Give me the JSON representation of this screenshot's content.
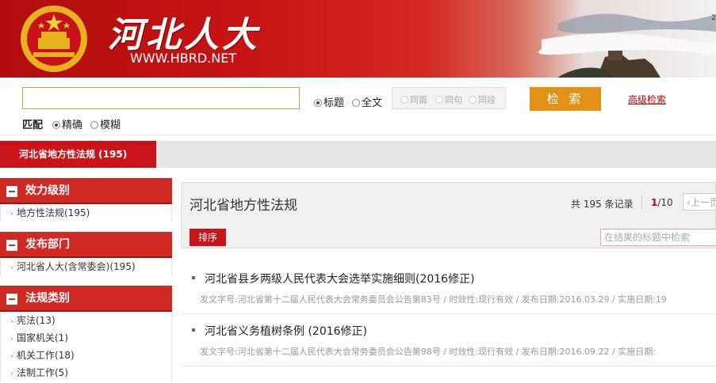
{
  "header": {
    "brand": "河北人大",
    "site_url": "WWW.HBRD.NET",
    "corner_mark": "2"
  },
  "search": {
    "query": "",
    "scope_options": [
      {
        "label": "标题",
        "checked": true
      },
      {
        "label": "全文",
        "checked": false
      }
    ],
    "proximity_options": [
      {
        "label": "同篇"
      },
      {
        "label": "同句"
      },
      {
        "label": "同段"
      }
    ],
    "button_label": "检 索",
    "advanced_link": "高级检索",
    "match_label": "匹配",
    "match_options": [
      {
        "label": "精确",
        "checked": true
      },
      {
        "label": "模糊",
        "checked": false
      }
    ]
  },
  "tab": {
    "active_label": "河北省地方性法规 (195)"
  },
  "sidebar": {
    "groups": [
      {
        "title": "效力级别",
        "items": [
          "地方性法规(195)"
        ]
      },
      {
        "title": "发布部门",
        "items": [
          "河北省人大(含常委会)(195)"
        ]
      },
      {
        "title": "法规类别",
        "items": [
          "宪法(13)",
          "国家机关(1)",
          "机关工作(18)",
          "法制工作(5)"
        ]
      }
    ]
  },
  "main": {
    "title": "河北省地方性法规",
    "total_label": "共 195 条记录",
    "page_current": "1",
    "page_total": "/10",
    "prev_label": "上一页",
    "sort_label": "排序",
    "filter_placeholder": "在结果的标题中检索"
  },
  "results": [
    {
      "title": "河北省县乡两级人民代表大会选举实施细则(2016修正)",
      "meta": "发文字号:河北省第十二届人民代表大会常务委员会公告第83号 / 时效性:现行有效 / 发布日期:2016.03.29 / 实施日期:19"
    },
    {
      "title": "河北省义务植树条例 (2016修正)",
      "meta": "发文字号:河北省第十二届人民代表大会常务委员会公告第98号 / 时效性:现行有效 / 发布日期:2016.09.22 / 实施日期:"
    }
  ],
  "colors": {
    "brand_red": "#c9141a",
    "button_orange": "#e39116",
    "link_red": "#c00000"
  }
}
